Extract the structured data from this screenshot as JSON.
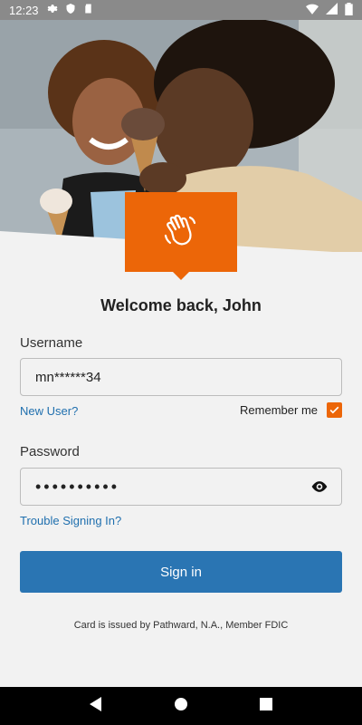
{
  "status_bar": {
    "time": "12:23",
    "icons_left": [
      "settings-gear-icon",
      "shield-icon",
      "sd-card-icon"
    ],
    "icons_right": [
      "wifi-icon",
      "signal-icon",
      "battery-icon"
    ]
  },
  "hero": {
    "image": "photo of smiling couple with ice cream",
    "badge_icon": "waving-hand-icon"
  },
  "welcome": "Welcome back, John",
  "username": {
    "label": "Username",
    "value": "mn******34",
    "new_user_link": "New User?",
    "remember_label": "Remember me",
    "remember_checked": true
  },
  "password": {
    "label": "Password",
    "value": "••••••••••",
    "trouble_link": "Trouble Signing In?"
  },
  "signin_button": "Sign in",
  "footer": "Card is issued by Pathward, N.A., Member FDIC",
  "nav": [
    "back-icon",
    "home-icon",
    "recents-icon"
  ],
  "colors": {
    "accent": "#ec6608",
    "primary": "#2a75b3",
    "link": "#1f6fae"
  }
}
